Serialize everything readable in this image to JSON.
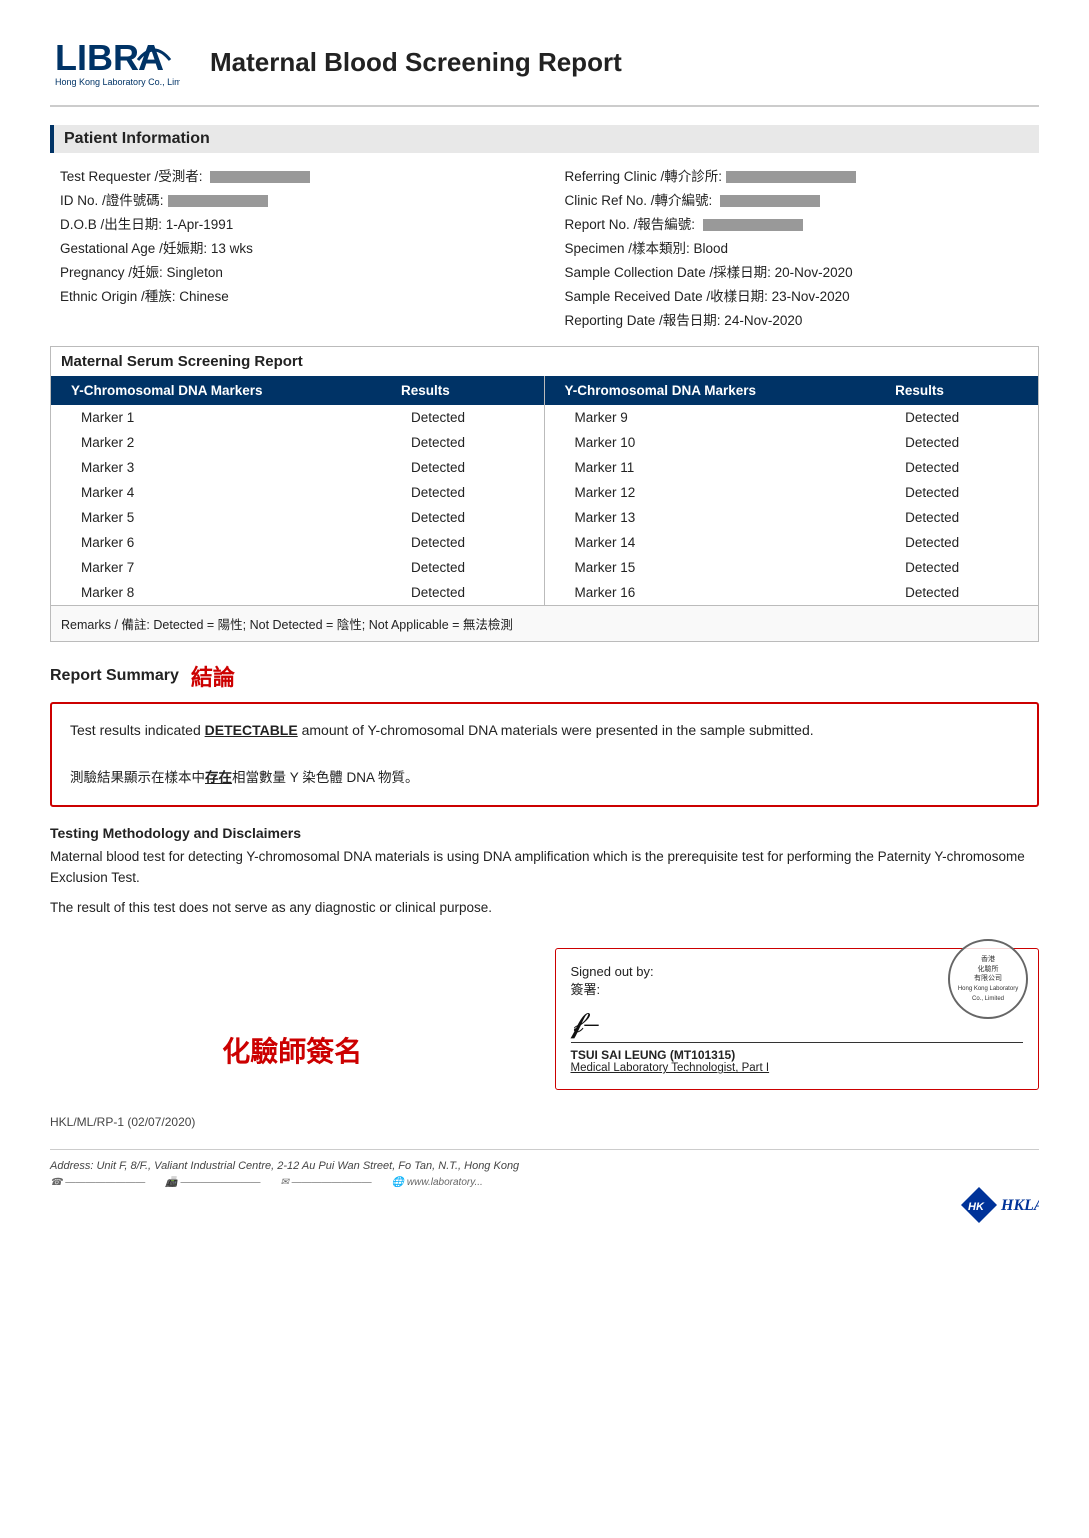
{
  "header": {
    "logo_company": "Hong Kong Laboratory Co., Limited",
    "report_title": "Maternal Blood Screening Report"
  },
  "patient_info": {
    "section_title": "Patient Information",
    "left": [
      {
        "label": "Test Requester /受測者:",
        "value": "REDACTED"
      },
      {
        "label": "ID No. /證件號碼:",
        "value": "REDACTED"
      },
      {
        "label": "D.O.B /出生日期:",
        "value": "1-Apr-1991"
      },
      {
        "label": "Gestational Age /妊娠期:",
        "value": "13 wks"
      },
      {
        "label": "Pregnancy /妊娠:",
        "value": "Singleton"
      },
      {
        "label": "Ethnic Origin /種族:",
        "value": "Chinese"
      }
    ],
    "right": [
      {
        "label": "Referring Clinic /轉介診所:",
        "value": "REDACTED"
      },
      {
        "label": "Clinic Ref No. /轉介編號:",
        "value": "REDACTED"
      },
      {
        "label": "Report No. /報告編號:",
        "value": "REDACTED"
      },
      {
        "label": "Specimen /樣本類別:",
        "value": "Blood"
      },
      {
        "label": "Sample Collection Date /採樣日期:",
        "value": "20-Nov-2020"
      },
      {
        "label": "Sample Received Date /收樣日期:",
        "value": "23-Nov-2020"
      },
      {
        "label": "Reporting Date /報告日期:",
        "value": "24-Nov-2020"
      }
    ]
  },
  "maternal_section": {
    "section_title": "Maternal Serum Screening Report",
    "table_header_marker": "Y-Chromosomal DNA Markers",
    "table_header_results": "Results",
    "left_markers": [
      {
        "name": "Marker 1",
        "result": "Detected"
      },
      {
        "name": "Marker 2",
        "result": "Detected"
      },
      {
        "name": "Marker 3",
        "result": "Detected"
      },
      {
        "name": "Marker 4",
        "result": "Detected"
      },
      {
        "name": "Marker 5",
        "result": "Detected"
      },
      {
        "name": "Marker 6",
        "result": "Detected"
      },
      {
        "name": "Marker 7",
        "result": "Detected"
      },
      {
        "name": "Marker 8",
        "result": "Detected"
      }
    ],
    "right_markers": [
      {
        "name": "Marker 9",
        "result": "Detected"
      },
      {
        "name": "Marker 10",
        "result": "Detected"
      },
      {
        "name": "Marker 11",
        "result": "Detected"
      },
      {
        "name": "Marker 12",
        "result": "Detected"
      },
      {
        "name": "Marker 13",
        "result": "Detected"
      },
      {
        "name": "Marker 14",
        "result": "Detected"
      },
      {
        "name": "Marker 15",
        "result": "Detected"
      },
      {
        "name": "Marker 16",
        "result": "Detected"
      }
    ],
    "remarks": "Remarks /  備註: Detected = 陽性; Not Detected = 陰性; Not Applicable = 無法檢測"
  },
  "report_summary": {
    "section_title": "Report Summary",
    "section_title_chinese": "結論",
    "summary_en": "Test results indicated DETECTABLE amount of Y-chromosomal DNA materials were presented in the sample submitted.",
    "summary_zh": "測驗結果顯示在樣本中存在相當數量 Y 染色體 DNA 物質。"
  },
  "methodology": {
    "title": "Testing Methodology and Disclaimers",
    "text1": "Maternal blood test for detecting Y-chromosomal DNA materials is using DNA amplification which is the prerequisite test for performing the Paternity Y-chromosome Exclusion Test.",
    "text2": "The result of this test does not serve as any diagnostic or clinical purpose."
  },
  "signature": {
    "signatory_left_zh": "化驗師簽名",
    "signed_out_by": "Signed out by:",
    "signed_out_by_zh": "簽署:",
    "name": "TSUI SAI LEUNG (MT101315)",
    "title": "Medical Laboratory Technologist, Part I"
  },
  "footer": {
    "code": "HKL/ML/RP-1 (02/07/2020)",
    "address": "Address: Unit F, 8/F., Valiant Industrial Centre, 2-12 Au Pui Wan Street, Fo Tan, N.T., Hong Kong",
    "contacts": [
      "",
      "",
      "",
      ""
    ]
  }
}
